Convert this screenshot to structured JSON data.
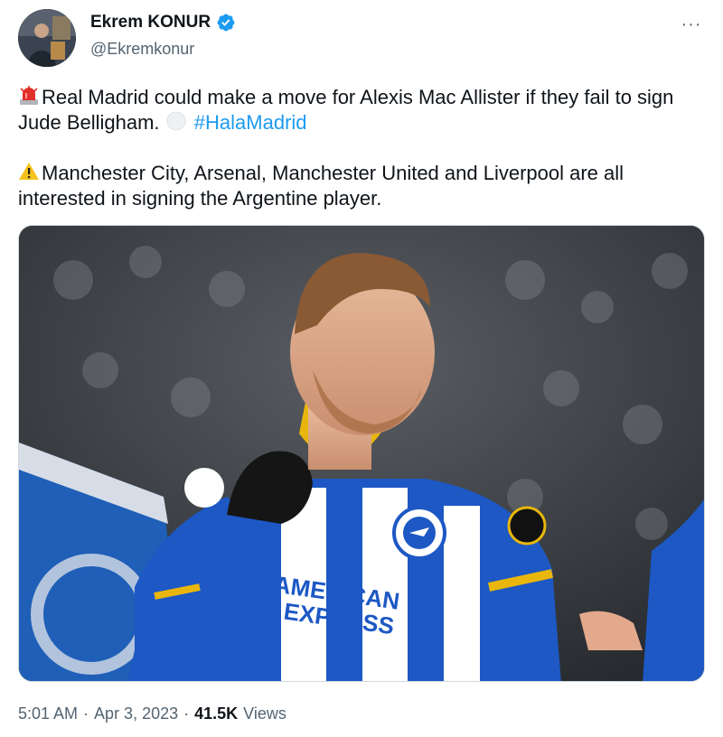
{
  "user": {
    "display_name": "Ekrem KONUR",
    "handle": "@Ekremkonur",
    "verified_icon": "verified-badge-icon",
    "verified_color": "#1d9bf0"
  },
  "more_icon": "···",
  "tweet": {
    "line1_emoji": "rotating-light-icon",
    "line1_text": "Real Madrid could make a move for Alexis Mac Allister if they fail to sign Jude Belligham.",
    "line1_emoji2": "white-circle-icon",
    "hashtag": "#HalaMadrid",
    "line2_emoji": "warning-icon",
    "line2_text": "Manchester City, Arsenal, Manchester United and Liverpool are all interested in signing the Argentine player."
  },
  "meta": {
    "time": "5:01 AM",
    "sep1": "·",
    "date": "Apr 3, 2023",
    "sep2": "·",
    "views_count": "41.5K",
    "views_label": "Views"
  },
  "colors": {
    "text": "#0f1419",
    "secondary": "#536471",
    "link": "#1d9bf0",
    "brighton_blue": "#1d58c4",
    "brighton_gold": "#e8b60c"
  },
  "jersey_text": {
    "line1": "AMERICAN",
    "line2": "EXPRESS"
  }
}
